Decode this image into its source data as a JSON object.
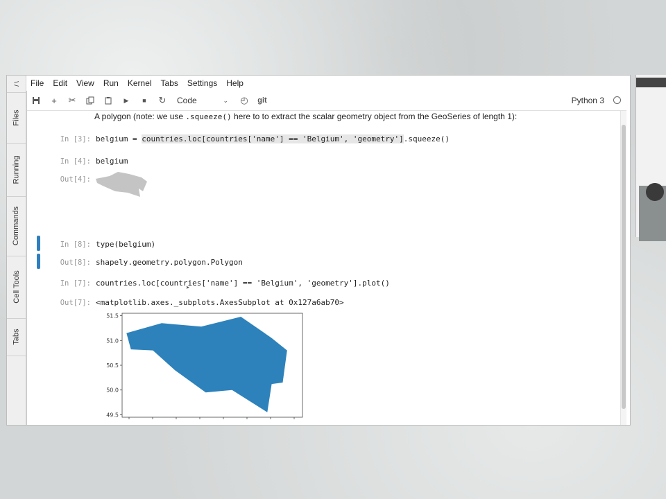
{
  "menu": [
    "File",
    "Edit",
    "View",
    "Run",
    "Kernel",
    "Tabs",
    "Settings",
    "Help"
  ],
  "side_tabs": [
    "Files",
    "Running",
    "Commands",
    "Cell Tools",
    "Tabs"
  ],
  "toolbar": {
    "cell_type": "Code",
    "git_label": "git",
    "kernel_name": "Python 3"
  },
  "markdown": {
    "before": "A polygon (note: we use ",
    "code": ".squeeze()",
    "after": " here to to extract the scalar geometry object from the GeoSeries of length 1):"
  },
  "cells": [
    {
      "prompt": "In [3]:",
      "code_pre": "belgium = ",
      "code_hl": "countries.loc[countries['name'] == 'Belgium', 'geometry']",
      "code_post": ".squeeze()"
    },
    {
      "prompt": "In [4]:",
      "code": "belgium"
    },
    {
      "prompt": "Out[4]:"
    },
    {
      "prompt": "In [8]:",
      "code_pre": "type(",
      "code_mid": "belgium",
      "code_post": ")"
    },
    {
      "prompt": "Out[8]:",
      "code": "shapely.geometry.polygon.Polygon"
    },
    {
      "prompt": "In [7]:",
      "code": "countries.loc[countries['name'] == 'Belgium', 'geometry'].plot()"
    },
    {
      "prompt": "Out[7]:",
      "code": "<matplotlib.axes._subplots.AxesSubplot at 0x127a6ab70>"
    }
  ],
  "chart_data": {
    "type": "area",
    "title": "",
    "xlabel": "",
    "ylabel": "",
    "yticks": [
      "51.5",
      "51.0",
      "50.5",
      "50.0",
      "49.5"
    ],
    "ylim": [
      49.45,
      51.55
    ],
    "xlim": [
      2.4,
      6.5
    ],
    "fill_color": "#2d82bb",
    "polygon": [
      [
        2.5,
        51.15
      ],
      [
        3.3,
        51.35
      ],
      [
        4.2,
        51.28
      ],
      [
        5.1,
        51.48
      ],
      [
        5.8,
        51.05
      ],
      [
        6.15,
        50.8
      ],
      [
        6.05,
        50.15
      ],
      [
        5.8,
        50.12
      ],
      [
        5.7,
        49.55
      ],
      [
        4.9,
        50.0
      ],
      [
        4.3,
        49.95
      ],
      [
        3.6,
        50.4
      ],
      [
        3.1,
        50.8
      ],
      [
        2.6,
        50.82
      ]
    ],
    "grid": false
  }
}
